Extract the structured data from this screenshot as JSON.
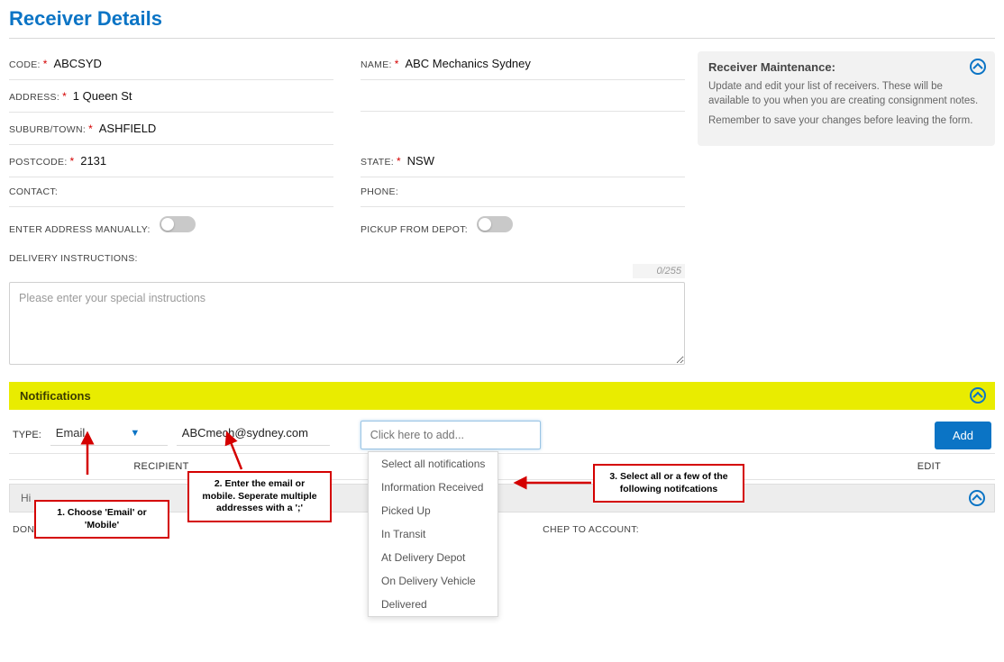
{
  "page_title": "Receiver Details",
  "info_panel": {
    "heading": "Receiver Maintenance:",
    "line1": "Update and edit your list of receivers. These will be available to you when you are creating consignment notes.",
    "line2": "Remember to save your changes before leaving the form."
  },
  "fields": {
    "code_label": "CODE:",
    "code_value": "ABCSYD",
    "name_label": "NAME:",
    "name_value": "ABC Mechanics Sydney",
    "address_label": "ADDRESS:",
    "address_value": "1 Queen St",
    "suburb_label": "SUBURB/TOWN:",
    "suburb_value": "ASHFIELD",
    "postcode_label": "POSTCODE:",
    "postcode_value": "2131",
    "state_label": "STATE:",
    "state_value": "NSW",
    "contact_label": "CONTACT:",
    "contact_value": "",
    "phone_label": "PHONE:",
    "phone_value": "",
    "manual_label": "ENTER ADDRESS MANUALLY:",
    "depot_label": "PICKUP FROM DEPOT:",
    "instructions_label": "DELIVERY INSTRUCTIONS:",
    "instructions_placeholder": "Please enter your special instructions",
    "char_count": "0/255"
  },
  "notifications": {
    "bar_label": "Notifications",
    "type_label": "TYPE:",
    "type_value": "Email",
    "recipient": "ABCmech@sydney.com",
    "add_placeholder": "Click here to add...",
    "add_button": "Add",
    "options": [
      "Select all notifications",
      "Information Received",
      "Picked Up",
      "In Transit",
      "At Delivery Depot",
      "On Delivery Vehicle",
      "Delivered"
    ],
    "col_recipient": "RECIPIENT",
    "col_edit": "EDIT"
  },
  "hide_bar": {
    "label_prefix": "Hi"
  },
  "bottom": {
    "chep_upload_label": "DON'T UPLOAD CHEP:",
    "chep_account_label": "CHEP TO ACCOUNT:"
  },
  "callouts": {
    "c1": "1. Choose 'Email' or 'Mobile'",
    "c2": "2. Enter the email or mobile. Seperate multiple addresses with a ';'",
    "c3": "3. Select all or a few of the following notifcations"
  }
}
